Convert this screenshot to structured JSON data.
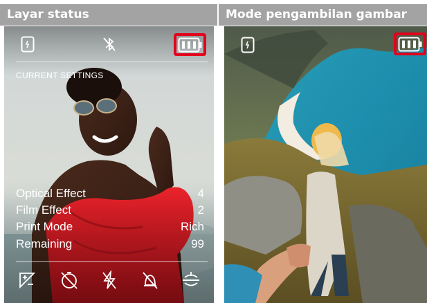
{
  "headers": {
    "left": "Layar status",
    "right": "Mode pengambilan gambar"
  },
  "status_screen": {
    "top_icons": [
      "phone-connected-icon",
      "bluetooth-off-icon",
      "battery-full-icon"
    ],
    "section_label": "CURRENT SETTINGS",
    "settings": [
      {
        "name": "Optical Effect",
        "value": "4"
      },
      {
        "name": "Film Effect",
        "value": "2"
      },
      {
        "name": "Print Mode",
        "value": "Rich"
      },
      {
        "name": "Remaining",
        "value": "99"
      }
    ],
    "bottom_icons": [
      "exposure-compensation-icon",
      "self-timer-off-icon",
      "flash-off-icon",
      "sound-off-icon",
      "vignette-icon"
    ]
  },
  "capture_mode": {
    "top_icons": [
      "phone-connected-icon",
      "battery-full-icon"
    ]
  },
  "colors": {
    "header_bg": "#a3a3a3",
    "highlight": "#e3001b"
  }
}
